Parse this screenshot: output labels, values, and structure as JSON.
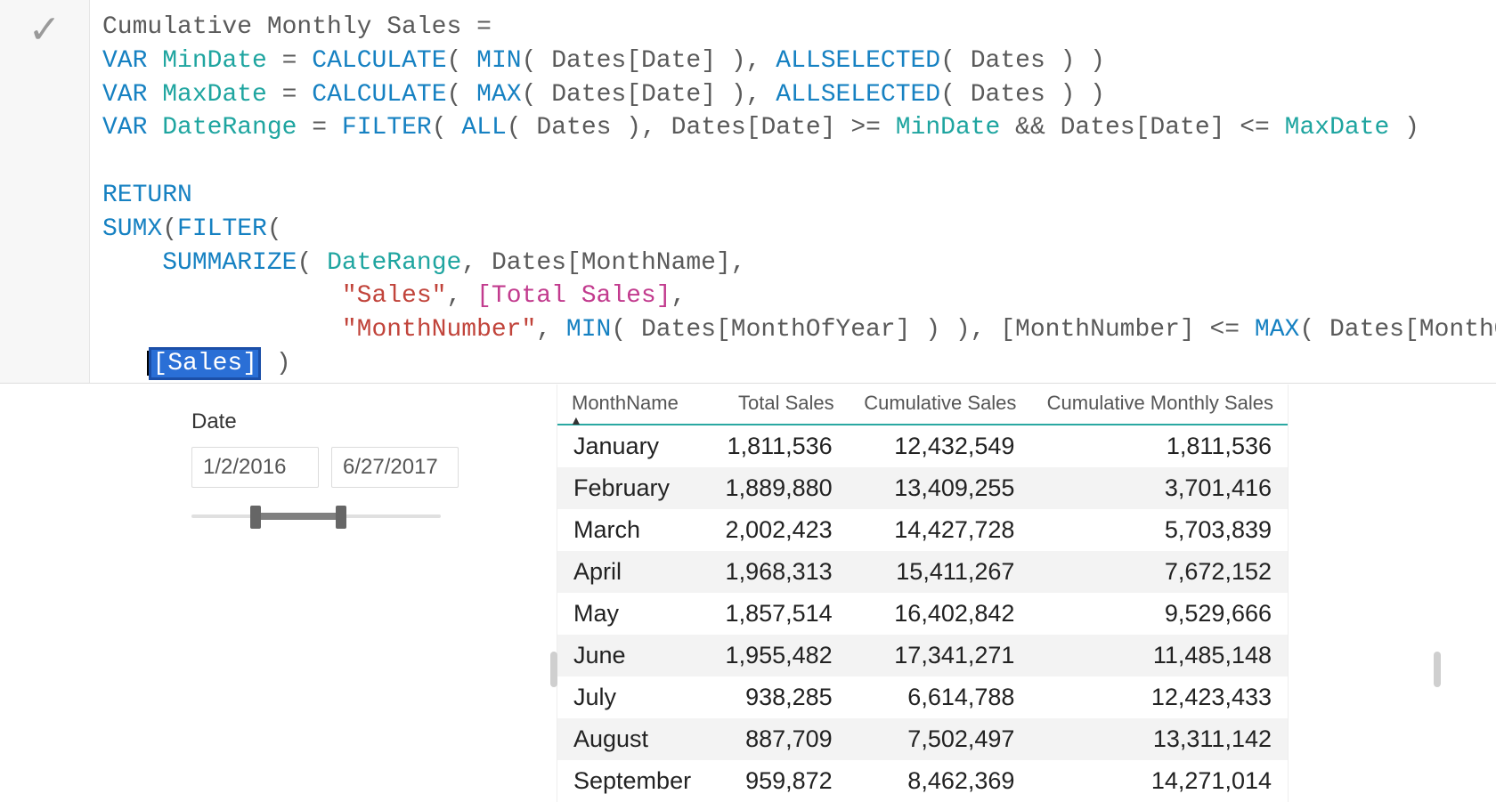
{
  "page_title_fragment": "Cum",
  "formula": {
    "line1_plain": "Cumulative Monthly Sales =",
    "var_kw": "VAR",
    "mindate_name": "MinDate",
    "calc_fn": "CALCULATE",
    "min_fn": "MIN",
    "max_fn": "MAX",
    "dates_date": "Dates[Date]",
    "allsel_fn": "ALLSELECTED",
    "dates_tbl": "Dates",
    "maxdate_name": "MaxDate",
    "daterange_name": "DateRange",
    "filter_fn": "FILTER",
    "all_fn": "ALL",
    "return_kw": "RETURN",
    "sumx_fn": "SUMX",
    "summarize_fn": "SUMMARIZE",
    "monthname_col": "Dates[MonthName]",
    "sales_str": "\"Sales\"",
    "total_sales_meas": "[Total Sales]",
    "monthnum_str": "\"MonthNumber\"",
    "monthofyear_col": "Dates[MonthOfYear]",
    "monthnumber_ref": "[MonthNumber]",
    "sales_sel": "[Sales]"
  },
  "slicer": {
    "label": "Date",
    "date_start": "1/2/2016",
    "date_end": "6/27/2017"
  },
  "table": {
    "headers": [
      "MonthName",
      "Total Sales",
      "Cumulative Sales",
      "Cumulative Monthly Sales"
    ],
    "rows": [
      {
        "month": "January",
        "total": "1,811,536",
        "cum": "12,432,549",
        "cms": "1,811,536"
      },
      {
        "month": "February",
        "total": "1,889,880",
        "cum": "13,409,255",
        "cms": "3,701,416"
      },
      {
        "month": "March",
        "total": "2,002,423",
        "cum": "14,427,728",
        "cms": "5,703,839"
      },
      {
        "month": "April",
        "total": "1,968,313",
        "cum": "15,411,267",
        "cms": "7,672,152"
      },
      {
        "month": "May",
        "total": "1,857,514",
        "cum": "16,402,842",
        "cms": "9,529,666"
      },
      {
        "month": "June",
        "total": "1,955,482",
        "cum": "17,341,271",
        "cms": "11,485,148"
      },
      {
        "month": "July",
        "total": "938,285",
        "cum": "6,614,788",
        "cms": "12,423,433"
      },
      {
        "month": "August",
        "total": "887,709",
        "cum": "7,502,497",
        "cms": "13,311,142"
      },
      {
        "month": "September",
        "total": "959,872",
        "cum": "8,462,369",
        "cms": "14,271,014"
      }
    ]
  }
}
